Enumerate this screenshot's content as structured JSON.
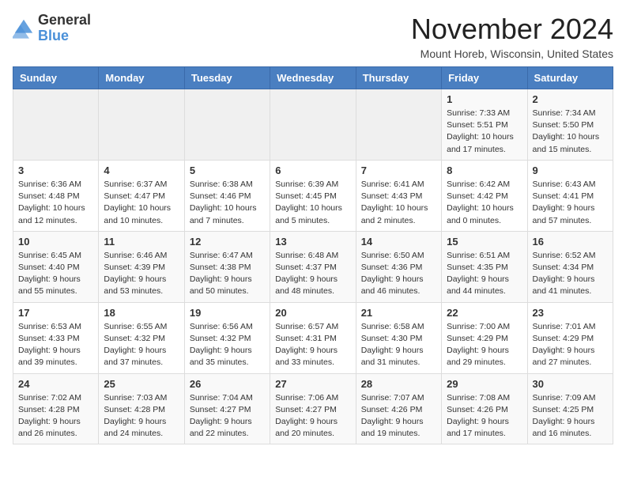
{
  "header": {
    "logo_general": "General",
    "logo_blue": "Blue",
    "month_year": "November 2024",
    "location": "Mount Horeb, Wisconsin, United States"
  },
  "weekdays": [
    "Sunday",
    "Monday",
    "Tuesday",
    "Wednesday",
    "Thursday",
    "Friday",
    "Saturday"
  ],
  "weeks": [
    [
      {
        "day": "",
        "info": ""
      },
      {
        "day": "",
        "info": ""
      },
      {
        "day": "",
        "info": ""
      },
      {
        "day": "",
        "info": ""
      },
      {
        "day": "",
        "info": ""
      },
      {
        "day": "1",
        "info": "Sunrise: 7:33 AM\nSunset: 5:51 PM\nDaylight: 10 hours\nand 17 minutes."
      },
      {
        "day": "2",
        "info": "Sunrise: 7:34 AM\nSunset: 5:50 PM\nDaylight: 10 hours\nand 15 minutes."
      }
    ],
    [
      {
        "day": "3",
        "info": "Sunrise: 6:36 AM\nSunset: 4:48 PM\nDaylight: 10 hours\nand 12 minutes."
      },
      {
        "day": "4",
        "info": "Sunrise: 6:37 AM\nSunset: 4:47 PM\nDaylight: 10 hours\nand 10 minutes."
      },
      {
        "day": "5",
        "info": "Sunrise: 6:38 AM\nSunset: 4:46 PM\nDaylight: 10 hours\nand 7 minutes."
      },
      {
        "day": "6",
        "info": "Sunrise: 6:39 AM\nSunset: 4:45 PM\nDaylight: 10 hours\nand 5 minutes."
      },
      {
        "day": "7",
        "info": "Sunrise: 6:41 AM\nSunset: 4:43 PM\nDaylight: 10 hours\nand 2 minutes."
      },
      {
        "day": "8",
        "info": "Sunrise: 6:42 AM\nSunset: 4:42 PM\nDaylight: 10 hours\nand 0 minutes."
      },
      {
        "day": "9",
        "info": "Sunrise: 6:43 AM\nSunset: 4:41 PM\nDaylight: 9 hours\nand 57 minutes."
      }
    ],
    [
      {
        "day": "10",
        "info": "Sunrise: 6:45 AM\nSunset: 4:40 PM\nDaylight: 9 hours\nand 55 minutes."
      },
      {
        "day": "11",
        "info": "Sunrise: 6:46 AM\nSunset: 4:39 PM\nDaylight: 9 hours\nand 53 minutes."
      },
      {
        "day": "12",
        "info": "Sunrise: 6:47 AM\nSunset: 4:38 PM\nDaylight: 9 hours\nand 50 minutes."
      },
      {
        "day": "13",
        "info": "Sunrise: 6:48 AM\nSunset: 4:37 PM\nDaylight: 9 hours\nand 48 minutes."
      },
      {
        "day": "14",
        "info": "Sunrise: 6:50 AM\nSunset: 4:36 PM\nDaylight: 9 hours\nand 46 minutes."
      },
      {
        "day": "15",
        "info": "Sunrise: 6:51 AM\nSunset: 4:35 PM\nDaylight: 9 hours\nand 44 minutes."
      },
      {
        "day": "16",
        "info": "Sunrise: 6:52 AM\nSunset: 4:34 PM\nDaylight: 9 hours\nand 41 minutes."
      }
    ],
    [
      {
        "day": "17",
        "info": "Sunrise: 6:53 AM\nSunset: 4:33 PM\nDaylight: 9 hours\nand 39 minutes."
      },
      {
        "day": "18",
        "info": "Sunrise: 6:55 AM\nSunset: 4:32 PM\nDaylight: 9 hours\nand 37 minutes."
      },
      {
        "day": "19",
        "info": "Sunrise: 6:56 AM\nSunset: 4:32 PM\nDaylight: 9 hours\nand 35 minutes."
      },
      {
        "day": "20",
        "info": "Sunrise: 6:57 AM\nSunset: 4:31 PM\nDaylight: 9 hours\nand 33 minutes."
      },
      {
        "day": "21",
        "info": "Sunrise: 6:58 AM\nSunset: 4:30 PM\nDaylight: 9 hours\nand 31 minutes."
      },
      {
        "day": "22",
        "info": "Sunrise: 7:00 AM\nSunset: 4:29 PM\nDaylight: 9 hours\nand 29 minutes."
      },
      {
        "day": "23",
        "info": "Sunrise: 7:01 AM\nSunset: 4:29 PM\nDaylight: 9 hours\nand 27 minutes."
      }
    ],
    [
      {
        "day": "24",
        "info": "Sunrise: 7:02 AM\nSunset: 4:28 PM\nDaylight: 9 hours\nand 26 minutes."
      },
      {
        "day": "25",
        "info": "Sunrise: 7:03 AM\nSunset: 4:28 PM\nDaylight: 9 hours\nand 24 minutes."
      },
      {
        "day": "26",
        "info": "Sunrise: 7:04 AM\nSunset: 4:27 PM\nDaylight: 9 hours\nand 22 minutes."
      },
      {
        "day": "27",
        "info": "Sunrise: 7:06 AM\nSunset: 4:27 PM\nDaylight: 9 hours\nand 20 minutes."
      },
      {
        "day": "28",
        "info": "Sunrise: 7:07 AM\nSunset: 4:26 PM\nDaylight: 9 hours\nand 19 minutes."
      },
      {
        "day": "29",
        "info": "Sunrise: 7:08 AM\nSunset: 4:26 PM\nDaylight: 9 hours\nand 17 minutes."
      },
      {
        "day": "30",
        "info": "Sunrise: 7:09 AM\nSunset: 4:25 PM\nDaylight: 9 hours\nand 16 minutes."
      }
    ]
  ]
}
